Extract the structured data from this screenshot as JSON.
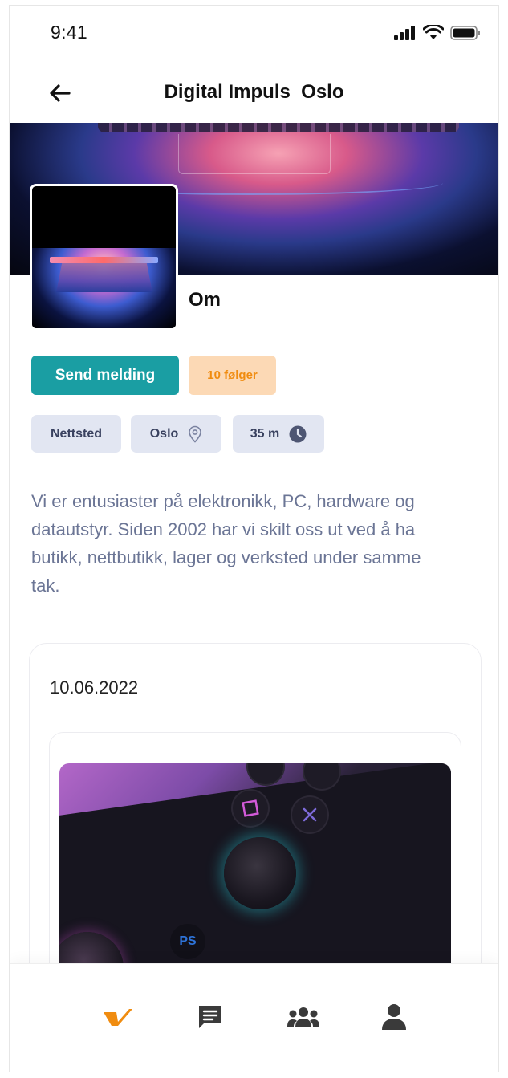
{
  "status_bar": {
    "time": "9:41"
  },
  "header": {
    "title": "Digital Impuls  Oslo"
  },
  "profile": {
    "section_title": "Om",
    "send_message_label": "Send melding",
    "followers_label": "10 følger"
  },
  "chips": {
    "website": "Nettsted",
    "location": "Oslo",
    "time": "35 m"
  },
  "about": "Vi er entusiaster på elektronikk, PC, hardware og datautstyr.  Siden 2002 har vi skilt oss ut ved å ha butikk, nettbutikk, lager og verksted under samme tak.",
  "post": {
    "date": "10.06.2022"
  },
  "colors": {
    "accent": "#1a9ea3",
    "follow_bg": "#fcd9b5",
    "follow_text": "#f08c10",
    "chip_bg": "#e2e6f2",
    "home_icon": "#f08c10"
  },
  "bottom_nav": {
    "items": [
      {
        "icon": "home-check-icon",
        "active": true
      },
      {
        "icon": "message-icon",
        "active": false
      },
      {
        "icon": "group-icon",
        "active": false
      },
      {
        "icon": "user-icon",
        "active": false
      }
    ]
  }
}
